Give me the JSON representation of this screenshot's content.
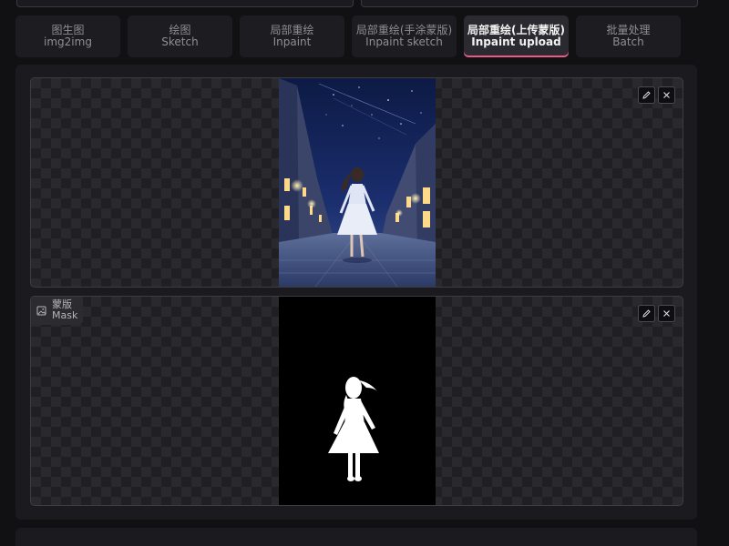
{
  "tabs": [
    {
      "zh": "图生图",
      "en": "img2img",
      "active": false
    },
    {
      "zh": "绘图",
      "en": "Sketch",
      "active": false
    },
    {
      "zh": "局部重绘",
      "en": "Inpaint",
      "active": false
    },
    {
      "zh": "局部重绘(手涂蒙版)",
      "en": "Inpaint sketch",
      "active": false
    },
    {
      "zh": "局部重绘(上传蒙版)",
      "en": "Inpaint upload",
      "active": true
    },
    {
      "zh": "批量处理",
      "en": "Batch",
      "active": false
    }
  ],
  "mask_panel": {
    "label_zh": "蒙版",
    "label_en": "Mask"
  },
  "icons": {
    "edit": "pencil-icon",
    "clear": "close-icon",
    "mask_label": "image-icon"
  },
  "colors": {
    "accent": "#e95b86",
    "background": "#111113",
    "panel": "#1b1b1f"
  }
}
